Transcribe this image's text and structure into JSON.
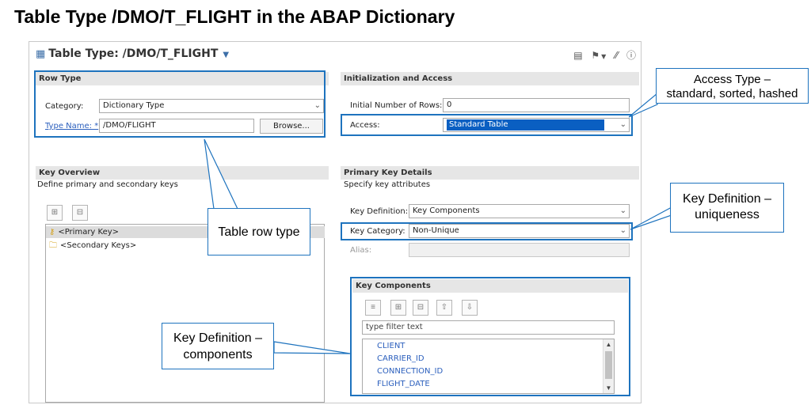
{
  "slide": {
    "title": "Table Type /DMO/T_FLIGHT in the ABAP Dictionary"
  },
  "editor": {
    "title": "Table Type: /DMO/T_FLIGHT",
    "toolbar_icons": [
      "notes-icon",
      "transport-icon",
      "dropdown-icon",
      "link-icon",
      "help-icon"
    ]
  },
  "row_type": {
    "header": "Row Type",
    "category_label": "Category:",
    "category_value": "Dictionary Type",
    "type_name_label": "Type Name: *",
    "type_name_value": "/DMO/FLIGHT",
    "browse_label": "Browse..."
  },
  "init_access": {
    "header": "Initialization and Access",
    "initial_rows_label": "Initial Number of Rows:",
    "initial_rows_value": "0",
    "access_label": "Access:",
    "access_value": "Standard Table"
  },
  "key_overview": {
    "header": "Key Overview",
    "subtitle": "Define primary and secondary keys",
    "items": [
      "<Primary Key>",
      "<Secondary Keys>"
    ]
  },
  "primary_key_details": {
    "header": "Primary Key Details",
    "subtitle": "Specify key attributes",
    "key_definition_label": "Key Definition:",
    "key_definition_value": "Key Components",
    "key_category_label": "Key Category:",
    "key_category_value": "Non-Unique",
    "alias_label": "Alias:",
    "alias_value": ""
  },
  "key_components": {
    "header": "Key Components",
    "filter_placeholder": "type filter text",
    "items": [
      "CLIENT",
      "CARRIER_ID",
      "CONNECTION_ID",
      "FLIGHT_DATE"
    ]
  },
  "callouts": {
    "access_type": {
      "line1": "Access Type –",
      "line2": "standard, sorted, hashed"
    },
    "key_definition_uniqueness": {
      "line1": "Key Definition –",
      "line2": "uniqueness"
    },
    "table_row_type": {
      "text": "Table row type"
    },
    "key_definition_components": {
      "line1": "Key Definition –",
      "line2": "components"
    }
  },
  "colors": {
    "highlight": "#1e73be",
    "selection": "#0a5fc2",
    "link": "#2b5fbd"
  }
}
